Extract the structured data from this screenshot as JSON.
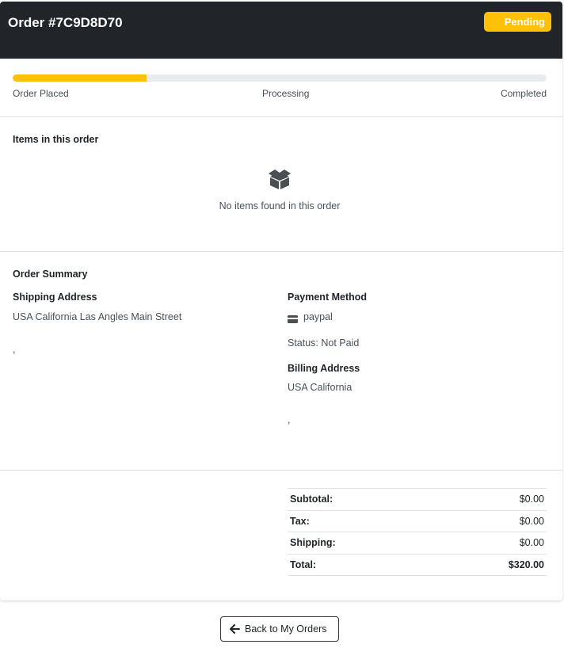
{
  "header": {
    "title": "Order #7C9D8D70",
    "status": "Pending",
    "status_color": "#ffc107",
    "background_color": "#212529"
  },
  "progress": {
    "value_percent": 25,
    "steps": [
      "Order Placed",
      "Processing",
      "Completed"
    ],
    "fill_color": "#ffc107"
  },
  "items_section": {
    "title": "Items in this order",
    "empty_icon": "box-open-icon",
    "empty_text": "No items found in this order"
  },
  "summary": {
    "title": "Order Summary",
    "shipping": {
      "heading": "Shipping Address",
      "line1": "USA California Las Angles Main Street",
      "line2": ","
    },
    "payment": {
      "heading": "Payment Method",
      "icon": "credit-card-icon",
      "method": "paypal",
      "status": "Status: Not Paid"
    },
    "billing": {
      "heading": "Billing Address",
      "line1": "USA California",
      "line2": ","
    }
  },
  "totals": {
    "rows": [
      {
        "label": "Subtotal:",
        "value": "$0.00"
      },
      {
        "label": "Tax:",
        "value": "$0.00"
      },
      {
        "label": "Shipping:",
        "value": "$0.00"
      },
      {
        "label": "Total:",
        "value": "$320.00"
      }
    ]
  },
  "back_button": {
    "icon": "arrow-left-icon",
    "label": "Back to My Orders"
  }
}
